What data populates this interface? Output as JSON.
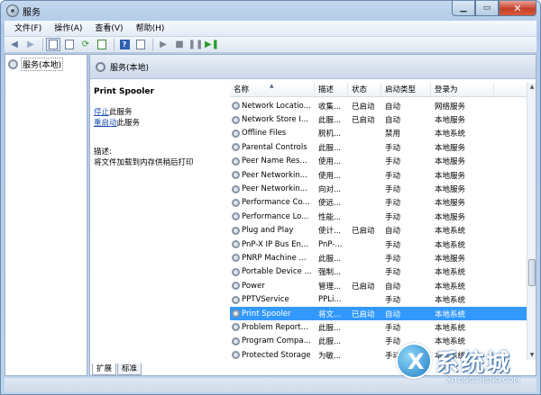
{
  "window": {
    "title": "服务"
  },
  "menubar": {
    "items": [
      "文件(F)",
      "操作(A)",
      "查看(V)",
      "帮助(H)"
    ]
  },
  "tree": {
    "root": "服务(本地)"
  },
  "main": {
    "header": "服务(本地)",
    "details": {
      "service_name": "Print Spooler",
      "stop_link": "停止",
      "stop_suffix": "此服务",
      "restart_link": "重启动",
      "restart_suffix": "此服务",
      "desc_label": "描述:",
      "desc_text": "将文件加载到内存供稍后打印"
    },
    "columns": [
      "名称",
      "描述",
      "状态",
      "启动类型",
      "登录为"
    ],
    "rows": [
      {
        "name": "Network Locatio...",
        "desc": "收集...",
        "state": "已启动",
        "start": "自动",
        "logon": "网络服务"
      },
      {
        "name": "Network Store I...",
        "desc": "此服...",
        "state": "已启动",
        "start": "自动",
        "logon": "本地服务"
      },
      {
        "name": "Offline Files",
        "desc": "脱机...",
        "state": "",
        "start": "禁用",
        "logon": "本地系统"
      },
      {
        "name": "Parental Controls",
        "desc": "此服...",
        "state": "",
        "start": "手动",
        "logon": "本地服务"
      },
      {
        "name": "Peer Name Res...",
        "desc": "使用...",
        "state": "",
        "start": "手动",
        "logon": "本地服务"
      },
      {
        "name": "Peer Networkin...",
        "desc": "使用...",
        "state": "",
        "start": "手动",
        "logon": "本地服务"
      },
      {
        "name": "Peer Networkin...",
        "desc": "向对...",
        "state": "",
        "start": "手动",
        "logon": "本地服务"
      },
      {
        "name": "Performance Co...",
        "desc": "使远...",
        "state": "",
        "start": "手动",
        "logon": "本地服务"
      },
      {
        "name": "Performance Lo...",
        "desc": "性能...",
        "state": "",
        "start": "手动",
        "logon": "本地服务"
      },
      {
        "name": "Plug and Play",
        "desc": "使计...",
        "state": "已启动",
        "start": "自动",
        "logon": "本地系统"
      },
      {
        "name": "PnP-X IP Bus En...",
        "desc": "PnP-...",
        "state": "",
        "start": "手动",
        "logon": "本地系统"
      },
      {
        "name": "PNRP Machine ...",
        "desc": "此服...",
        "state": "",
        "start": "手动",
        "logon": "本地服务"
      },
      {
        "name": "Portable Device ...",
        "desc": "强制...",
        "state": "",
        "start": "手动",
        "logon": "本地系统"
      },
      {
        "name": "Power",
        "desc": "管理...",
        "state": "已启动",
        "start": "自动",
        "logon": "本地系统"
      },
      {
        "name": "PPTVService",
        "desc": "PPLi...",
        "state": "",
        "start": "手动",
        "logon": "本地系统"
      },
      {
        "name": "Print Spooler",
        "desc": "将文...",
        "state": "已启动",
        "start": "自动",
        "logon": "本地系统",
        "selected": true
      },
      {
        "name": "Problem Report...",
        "desc": "此服...",
        "state": "",
        "start": "手动",
        "logon": "本地系统"
      },
      {
        "name": "Program Compa...",
        "desc": "此服...",
        "state": "",
        "start": "手动",
        "logon": "本地系统"
      },
      {
        "name": "Protected Storage",
        "desc": "为敏...",
        "state": "",
        "start": "手动",
        "logon": "本地系统"
      }
    ],
    "tabs": [
      "扩展",
      "标准"
    ]
  },
  "watermark": {
    "text": "系统城",
    "sub": "XITONGCHENG.COM"
  },
  "colors": {
    "selection": "#3399ff",
    "link": "#1f4fb4",
    "close": "#c7402c"
  },
  "icons": {
    "toolbar": [
      "back-arrow-icon",
      "forward-arrow-icon",
      "console-tree-icon",
      "properties-icon",
      "refresh-icon",
      "export-list-icon",
      "help-icon",
      "action-pane-icon",
      "start-service-icon",
      "stop-service-icon",
      "pause-service-icon",
      "restart-service-icon"
    ]
  }
}
